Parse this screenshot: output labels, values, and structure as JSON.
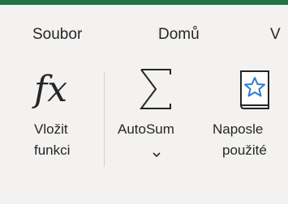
{
  "ribbon": {
    "accent_color": "#217346",
    "tabs": [
      {
        "label": "Soubor"
      },
      {
        "label": "Domů"
      },
      {
        "label": "V"
      }
    ]
  },
  "commands": {
    "insert_function": {
      "line1": "Vložit",
      "line2": "funkci",
      "icon": "fx-icon"
    },
    "autosum": {
      "label": "AutoSum",
      "icon": "sigma-icon",
      "dropdown_icon": "chevron-down-icon"
    },
    "recently_used": {
      "line1": "Naposle",
      "line2": "použité",
      "icon": "star-book-icon"
    }
  }
}
